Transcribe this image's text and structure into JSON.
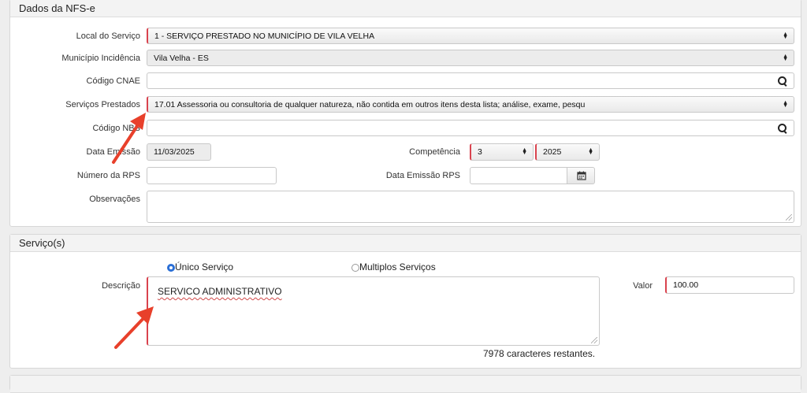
{
  "nfse_panel": {
    "title": "Dados da NFS-e",
    "local_servico": {
      "label": "Local do Serviço",
      "value": "1 - SERVIÇO PRESTADO NO MUNICÍPIO DE VILA VELHA"
    },
    "municipio_incidencia": {
      "label": "Município Incidência",
      "value": "Vila Velha - ES"
    },
    "codigo_cnae": {
      "label": "Código CNAE",
      "value": ""
    },
    "servicos_prestados": {
      "label": "Serviços Prestados",
      "value": "17.01 Assessoria ou consultoria de qualquer natureza, não contida em outros itens desta lista; análise, exame, pesqu"
    },
    "codigo_nbs": {
      "label": "Código NBS",
      "value": ""
    },
    "data_emissao": {
      "label": "Data Emissão",
      "value": "11/03/2025"
    },
    "competencia": {
      "label": "Competência",
      "month": "3",
      "year": "2025"
    },
    "numero_rps": {
      "label": "Número da RPS",
      "value": ""
    },
    "data_emissao_rps": {
      "label": "Data Emissão RPS",
      "value": ""
    },
    "observacoes": {
      "label": "Observações",
      "value": ""
    }
  },
  "servicos_panel": {
    "title": "Serviço(s)",
    "radio_unico": {
      "label": "Único Serviço",
      "selected": true
    },
    "radio_multiplos": {
      "label": "Multiplos Serviços",
      "selected": false
    },
    "descricao": {
      "label": "Descrição",
      "value": "SERVICO ADMINISTRATIVO"
    },
    "valor": {
      "label": "Valor",
      "value": "100.00"
    },
    "remaining": "7978 caracteres restantes."
  },
  "valores_panel": {
    "title": ""
  },
  "colors": {
    "required_accent": "#d9434e",
    "annotation_arrow": "#e8402b",
    "radio_selected": "#2b6fd6"
  },
  "icons": {
    "search": "magnifier-icon",
    "calendar": "calendar-icon",
    "select": "updown-caret-icon"
  }
}
